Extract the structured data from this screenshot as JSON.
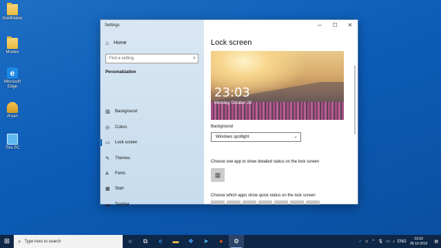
{
  "desktop": {
    "icons": [
      {
        "label": "GoldMaker",
        "icon": "folder-icon"
      },
      {
        "label": "Movies",
        "icon": "folder-icon"
      },
      {
        "label": "Microsoft Edge",
        "icon": "edge-icon"
      },
      {
        "label": "Aryan",
        "icon": "user-folder-icon"
      },
      {
        "label": "This PC",
        "icon": "computer-icon"
      }
    ]
  },
  "window": {
    "title": "Settings",
    "controls": {
      "minimize": "─",
      "maximize": "☐",
      "close": "✕"
    }
  },
  "nav": {
    "home_label": "Home",
    "search_placeholder": "Find a setting",
    "section_title": "Personalization",
    "items": [
      {
        "label": "Background",
        "icon": "background-icon",
        "glyph": "▨"
      },
      {
        "label": "Colors",
        "icon": "colors-icon",
        "glyph": "◎"
      },
      {
        "label": "Lock screen",
        "icon": "lock-screen-icon",
        "glyph": "▭",
        "active": true
      },
      {
        "label": "Themes",
        "icon": "themes-icon",
        "glyph": "✎"
      },
      {
        "label": "Fonts",
        "icon": "fonts-icon",
        "glyph": "A"
      },
      {
        "label": "Start",
        "icon": "start-icon",
        "glyph": "▦"
      },
      {
        "label": "Taskbar",
        "icon": "taskbar-icon",
        "glyph": "▬"
      }
    ]
  },
  "content": {
    "page_title": "Lock screen",
    "preview": {
      "time": "23:03",
      "date": "Monday, October 28"
    },
    "background_label": "Background",
    "background_value": "Windows spotlight",
    "detail_caption": "Choose one app to show detailed status on the lock screen",
    "quick_caption": "Choose which apps show quick status on the lock screen"
  },
  "taskbar": {
    "search_placeholder": "Type here to search",
    "tray_language": "ENG",
    "clock_time": "23:03",
    "clock_date": "28-10-2019"
  },
  "colors": {
    "accent": "#0063b1",
    "taskbar": "#0f2746",
    "desktop": "#0c5cb8"
  }
}
